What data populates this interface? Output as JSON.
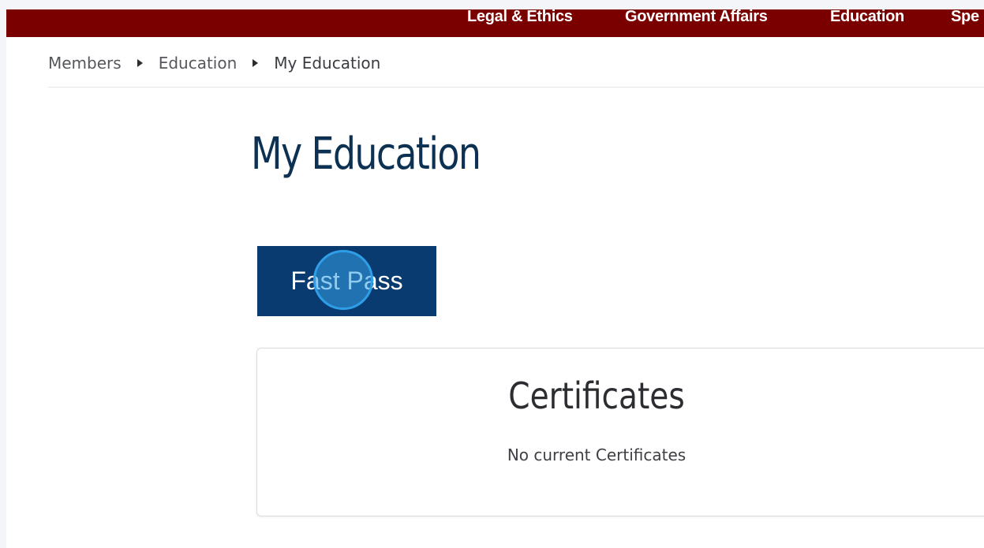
{
  "top_nav": {
    "items": [
      {
        "label": "Legal & Ethics"
      },
      {
        "label": "Government Affairs"
      },
      {
        "label": "Education"
      },
      {
        "label": "Spe"
      }
    ],
    "background_color": "#7a0000"
  },
  "breadcrumb": {
    "items": [
      {
        "label": "Members"
      },
      {
        "label": "Education"
      },
      {
        "label": "My Education"
      }
    ],
    "separator_icon": "triangle-right-icon"
  },
  "page": {
    "title": "My Education"
  },
  "fast_pass": {
    "label": "Fast Pass",
    "color": "#0a3b70"
  },
  "certificates": {
    "title": "Certificates",
    "empty_message": "No current Certificates"
  }
}
